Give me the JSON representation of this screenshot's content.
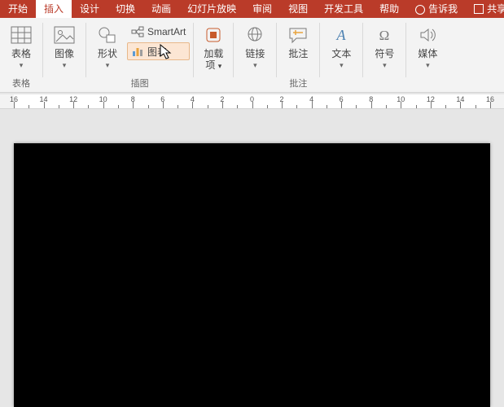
{
  "tabs": {
    "items": [
      {
        "label": "开始"
      },
      {
        "label": "插入"
      },
      {
        "label": "设计"
      },
      {
        "label": "切换"
      },
      {
        "label": "动画"
      },
      {
        "label": "幻灯片放映"
      },
      {
        "label": "审阅"
      },
      {
        "label": "视图"
      },
      {
        "label": "开发工具"
      },
      {
        "label": "帮助"
      }
    ],
    "active_index": 1,
    "tellme": "告诉我",
    "share": "共享"
  },
  "ribbon": {
    "table": {
      "label": "表格",
      "group": "表格"
    },
    "images": {
      "label": "图像"
    },
    "shapes": {
      "label": "形状"
    },
    "smartart": {
      "label": "SmartArt"
    },
    "chart": {
      "label": "图表"
    },
    "illustrations_group": "插图",
    "addins": {
      "label": "加载",
      "label2": "项"
    },
    "link": {
      "label": "链接"
    },
    "comment": {
      "label": "批注",
      "group": "批注"
    },
    "text": {
      "label": "文本"
    },
    "symbol": {
      "label": "符号"
    },
    "media": {
      "label": "媒体"
    }
  },
  "ruler": {
    "labels": [
      16,
      14,
      12,
      10,
      8,
      6,
      4,
      2,
      0,
      2,
      4,
      6,
      8,
      10,
      12,
      14,
      16
    ]
  },
  "colors": {
    "accent": "#ba3b29"
  }
}
